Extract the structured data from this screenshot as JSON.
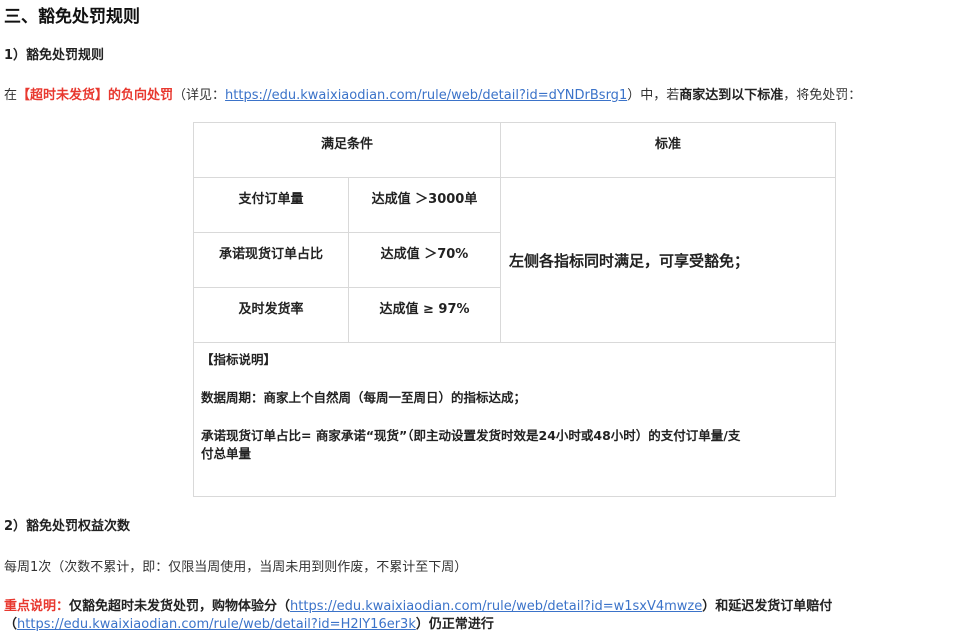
{
  "section_title": "三、豁免处罚规则",
  "sub1_title": "1）豁免处罚规则",
  "intro": {
    "prefix": "在",
    "red_text": "【超时未发货】的负向处罚",
    "mid": "（详见：",
    "link": "https://edu.kwaixiaodian.com/rule/web/detail?id=dYNDrBsrg1",
    "after_link": "）中，若",
    "bold_text": "商家达到以下标准",
    "suffix": "，将免处罚："
  },
  "table": {
    "header_condition": "满足条件",
    "header_standard": "标准",
    "rows": [
      {
        "metric": "支付订单量",
        "value": "达成值 ＞3000单"
      },
      {
        "metric": "承诺现货订单占比",
        "value": "达成值 ＞70%"
      },
      {
        "metric": "及时发货率",
        "value": "达成值 ≥ 97%"
      }
    ],
    "standard_text": "左侧各指标同时满足，可享受豁免；",
    "note_title": "【指标说明】",
    "note_period": "数据周期：商家上个自然周（每周一至周日）的指标达成；",
    "note_ratio_line1": "承诺现货订单占比= 商家承诺“现货”（即主动设置发货时效是24小时或48小时）的支付订单量/支",
    "note_ratio_line2": "付总单量"
  },
  "sub2_title": "2）豁免处罚权益次数",
  "frequency": "每周1次（次数不累计，即：仅限当周使用，当周未用到则作废，不累计至下周）",
  "key_note": {
    "label": "重点说明：",
    "text1": "仅豁免超时未发货处罚，购物体验分（",
    "link1": "https://edu.kwaixiaodian.com/rule/web/detail?id=w1sxV4mwze",
    "text2": "）和延迟发货订单赔付",
    "text3": "（",
    "link2": "https://edu.kwaixiaodian.com/rule/web/detail?id=H2lY16er3k",
    "text4": "）仍正常进行"
  }
}
